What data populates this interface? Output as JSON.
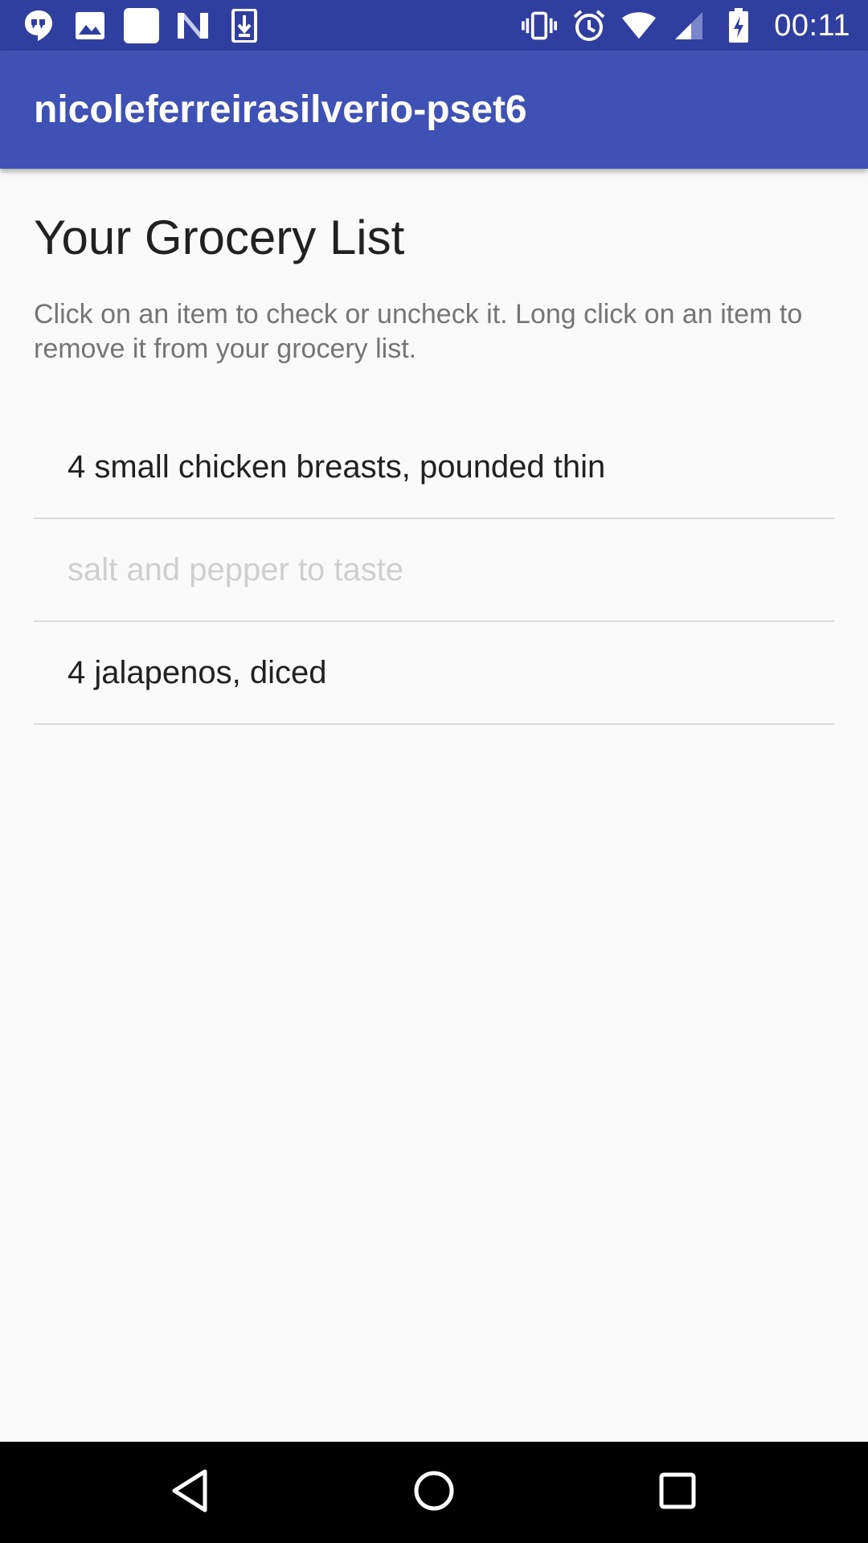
{
  "status_bar": {
    "time": "00:11",
    "left_icons": [
      "hangouts-icon",
      "image-icon",
      "blank-notification-icon",
      "n-app-icon",
      "download-icon"
    ],
    "right_icons": [
      "vibrate-icon",
      "alarm-icon",
      "wifi-icon",
      "cell-signal-icon",
      "battery-charging-icon"
    ]
  },
  "app_bar": {
    "title": "nicoleferreirasilverio-pset6"
  },
  "main": {
    "heading": "Your Grocery List",
    "instructions": "Click on an item to check or uncheck it. Long click on an item to remove it from your grocery list.",
    "items": [
      {
        "label": "4 small chicken breasts, pounded thin",
        "checked": false
      },
      {
        "label": "salt and pepper to taste",
        "checked": true
      },
      {
        "label": "4 jalapenos, diced",
        "checked": false
      }
    ]
  },
  "nav_bar": {
    "buttons": [
      "back-icon",
      "home-icon",
      "recents-icon"
    ]
  },
  "colors": {
    "status_bar": "#303f9f",
    "app_bar": "#3f51b5",
    "background": "#fafafa",
    "checked_text": "#cfcfcf",
    "unchecked_text": "#212121",
    "divider": "#dcdcdc"
  }
}
